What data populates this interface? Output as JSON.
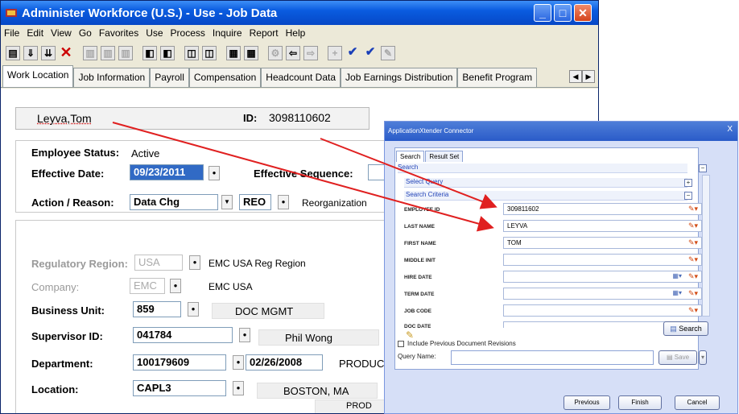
{
  "main": {
    "title": "Administer Workforce (U.S.) - Use - Job Data",
    "menu": [
      "File",
      "Edit",
      "View",
      "Go",
      "Favorites",
      "Use",
      "Process",
      "Inquire",
      "Report",
      "Help"
    ],
    "tabs": [
      "Work Location",
      "Job Information",
      "Payroll",
      "Compensation",
      "Headcount Data",
      "Job Earnings Distribution",
      "Benefit Program"
    ],
    "employee_name": "Leyva,Tom",
    "id_label": "ID:",
    "id_value": "3098110602",
    "employee_status_label": "Employee Status:",
    "employee_status_value": "Active",
    "effective_date_label": "Effective Date:",
    "effective_date_value": "09/23/2011",
    "effective_sequence_label": "Effective Sequence:",
    "action_reason_label": "Action / Reason:",
    "action_value": "Data Chg",
    "reason_code": "REO",
    "reason_desc": "Reorganization",
    "regulatory_region_label": "Regulatory Region:",
    "regulatory_region_value": "USA",
    "regulatory_region_desc": "EMC USA Reg Region",
    "company_label": "Company:",
    "company_value": "EMC",
    "company_desc": "EMC USA",
    "business_unit_label": "Business Unit:",
    "business_unit_value": "859",
    "business_unit_desc": "DOC MGMT",
    "supervisor_label": "Supervisor ID:",
    "supervisor_value": "041784",
    "supervisor_desc": "Phil Wong",
    "department_label": "Department:",
    "department_value": "100179609",
    "department_date": "02/26/2008",
    "department_desc": "PRODUCT",
    "location_label": "Location:",
    "location_value": "CAPL3",
    "location_desc": "BOSTON, MA",
    "bottom_text": "PROD"
  },
  "xtender": {
    "title": "ApplicationXtender Connector",
    "close": "X",
    "tabs": [
      "Search",
      "Result Set"
    ],
    "search_link": "Search",
    "select_query": "Select Query",
    "search_criteria": "Search Criteria",
    "fields": [
      {
        "label": "EMPLOYEE ID",
        "value": "309811602"
      },
      {
        "label": "LAST NAME",
        "value": "LEYVA"
      },
      {
        "label": "FIRST NAME",
        "value": "TOM"
      },
      {
        "label": "MIDDLE INIT",
        "value": ""
      },
      {
        "label": "HIRE DATE",
        "value": ""
      },
      {
        "label": "TERM DATE",
        "value": ""
      },
      {
        "label": "JOB CODE",
        "value": ""
      },
      {
        "label": "DOC DATE",
        "value": ""
      }
    ],
    "search_button": "Search",
    "include_revisions": "Include Previous Document Revisions",
    "query_name_label": "Query Name:",
    "save_button": "Save",
    "previous_button": "Previous",
    "finish_button": "Finish",
    "cancel_button": "Cancel"
  },
  "colors": {
    "title_blue": "#0a5ce0",
    "arrow_red": "#e02020",
    "selected_blue": "#316ac5"
  }
}
